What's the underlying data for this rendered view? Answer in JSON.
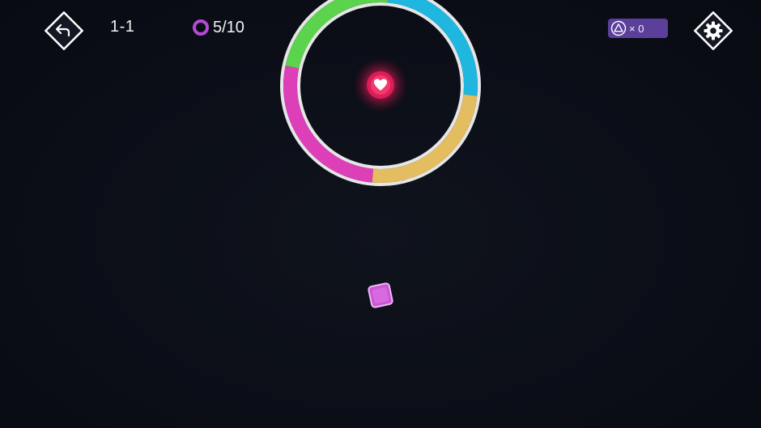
{
  "hud": {
    "level": "1-1",
    "rings": "5/10",
    "lives_multiplier": "× 0"
  },
  "colors": {
    "background": "#0b0e17",
    "ring_border": "#e8e8e8",
    "segment_cyan": "#1fb6e0",
    "segment_yellow": "#e3bd60",
    "segment_magenta": "#dd3fb9",
    "segment_green": "#5cd34d",
    "heart_glow": "#e81f5c",
    "player": "#cc55d6",
    "rings_icon": "#b64ad6",
    "lives_badge": "#5b3f9b"
  },
  "icons": {
    "back": "back-arrow-icon",
    "settings": "gear-icon",
    "rings": "ring-icon",
    "lives": "triangle-icon",
    "heart": "heart-icon"
  },
  "obstacle": {
    "type": "color-wheel",
    "segments": [
      "cyan",
      "yellow",
      "magenta",
      "green"
    ]
  }
}
